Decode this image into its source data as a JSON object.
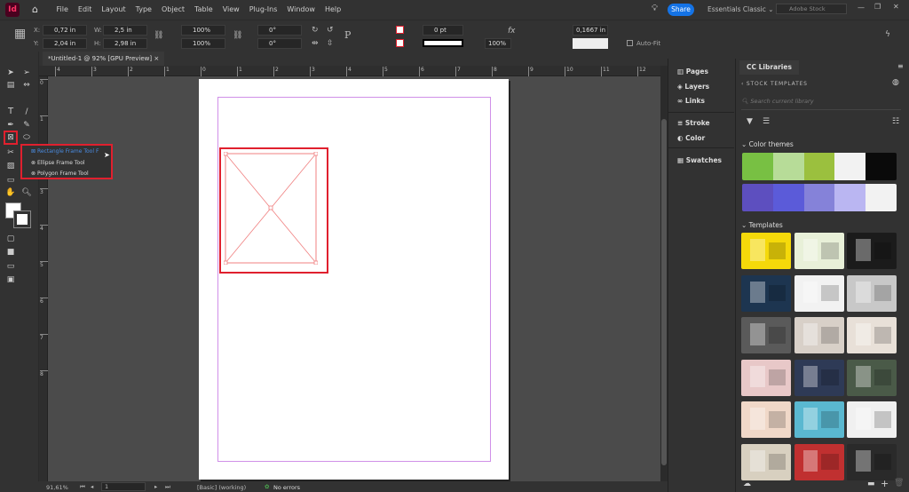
{
  "app": {
    "logo": "Id",
    "menu": [
      "File",
      "Edit",
      "Layout",
      "Type",
      "Object",
      "Table",
      "View",
      "Plug-Ins",
      "Window",
      "Help"
    ],
    "share": "Share",
    "workspace": "Essentials Classic",
    "stock_placeholder": "Adobe Stock"
  },
  "control": {
    "x_label": "X:",
    "x": "0,72 in",
    "y_label": "Y:",
    "y": "2,04 in",
    "w_label": "W:",
    "w": "2,5 in",
    "h_label": "H:",
    "h": "2,98 in",
    "scale_x": "100%",
    "scale_y": "100%",
    "rotate": "0°",
    "shear": "0°",
    "stroke_weight": "0 pt",
    "opacity": "100%",
    "gap": "0,1667 in",
    "autofit": "Auto-Fit"
  },
  "document": {
    "tab": "*Untitled-1 @ 92% [GPU Preview]"
  },
  "ruler": {
    "h": [
      "4",
      "3",
      "2",
      "1",
      "0",
      "1",
      "2",
      "3",
      "4",
      "5",
      "6",
      "7",
      "8",
      "9",
      "10",
      "11",
      "12"
    ],
    "v": [
      "0",
      "1",
      "2",
      "3",
      "4",
      "5",
      "6",
      "7",
      "8"
    ]
  },
  "flyout": {
    "items": [
      "Rectangle Frame Tool",
      "Ellipse Frame Tool",
      "Polygon Frame Tool"
    ],
    "shortcut": "F"
  },
  "status": {
    "zoom": "91,61%",
    "page": "1",
    "profile": "[Basic] (working)",
    "errors": "No errors"
  },
  "dock": [
    "Pages",
    "Layers",
    "Links",
    "Stroke",
    "Color",
    "Swatches"
  ],
  "cc": {
    "tab": "CC Libraries",
    "breadcrumb": "STOCK TEMPLATES",
    "search_placeholder": "Search current library",
    "color_themes": "Color themes",
    "templates": "Templates",
    "themes": [
      [
        "#78c043",
        "#b7dc98",
        "#9bc03e",
        "#f2f2f2",
        "#0a0a0a"
      ],
      [
        "#5d4fbf",
        "#5b5bd9",
        "#8582d9",
        "#bab6f2",
        "#f2f2f2"
      ]
    ],
    "thumbs": [
      "#f5d90a",
      "#e8f0d8",
      "#1b1b1b",
      "#1d3550",
      "#f2f2f2",
      "#c8c8c8",
      "#5a5a5a",
      "#d8d0c8",
      "#e8e0d8",
      "#e8c8c8",
      "#2e3a56",
      "#4a5a48",
      "#f0d8c8",
      "#5ab8d0",
      "#f0f0f0",
      "#d8d0c0",
      "#c03030",
      "#2a2a2a"
    ]
  },
  "colors": {
    "accent": "#1473e6",
    "highlight": "#e0202e",
    "frame": "#f08080",
    "guide": "#c080e0"
  }
}
